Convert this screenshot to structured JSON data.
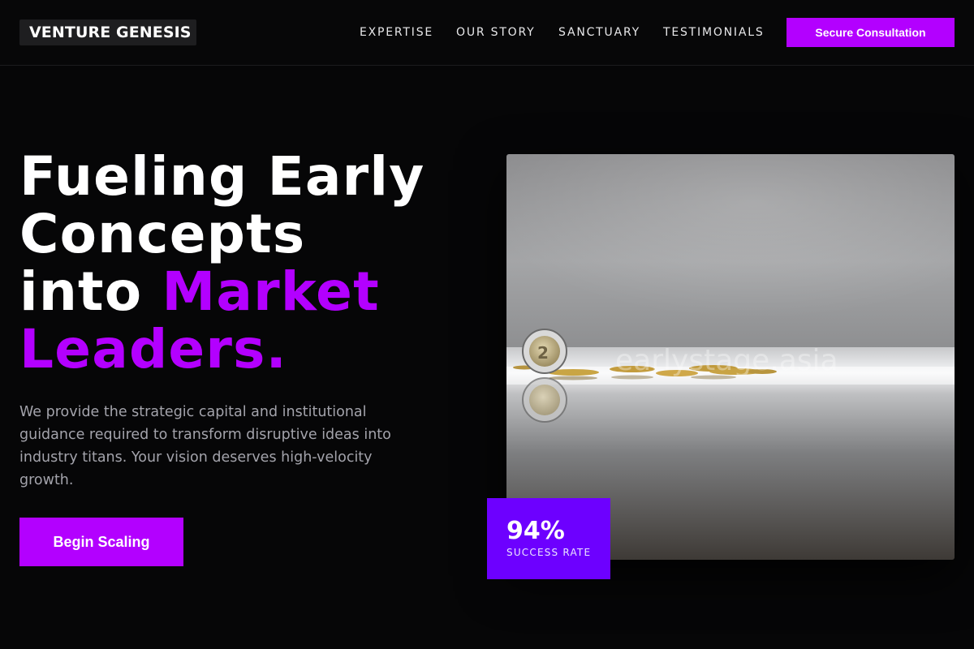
{
  "header": {
    "logo": "VENTURE GENESIS",
    "nav": [
      "EXPERTISE",
      "OUR STORY",
      "SANCTUARY",
      "TESTIMONIALS"
    ],
    "cta": "Secure Consultation"
  },
  "hero": {
    "title_line1": "Fueling Early",
    "title_line2": "Concepts",
    "title_line3_plain": "into ",
    "title_line3_accent": "Market",
    "title_line4_accent": "Leaders.",
    "description": "We provide the strategic capital and institutional guidance required to transform disruptive ideas into industry titans. Your vision deserves high-velocity growth.",
    "cta": "Begin Scaling"
  },
  "image": {
    "subject": "coins-on-reflective-surface",
    "watermark": "earlystage.asia"
  },
  "stat": {
    "value": "94%",
    "label": "SUCCESS RATE"
  },
  "colors": {
    "accent": "#b300ff",
    "stat_bg": "#6d00ff",
    "background": "#060607"
  }
}
